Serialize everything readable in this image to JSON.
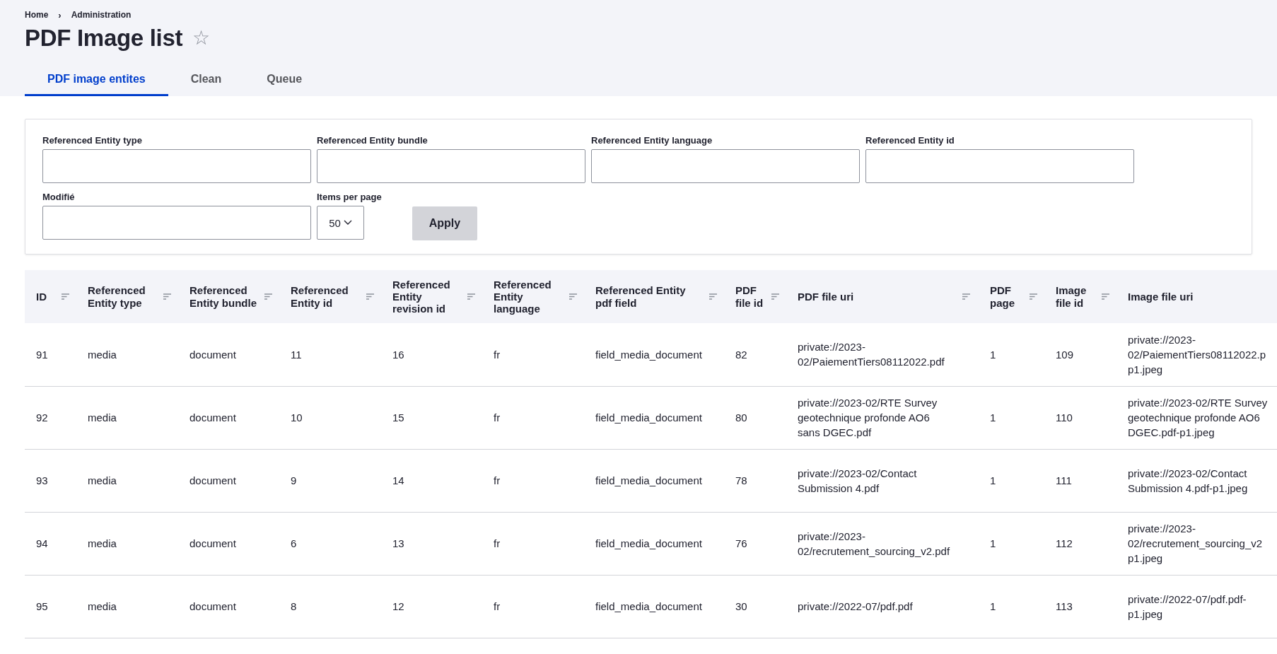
{
  "breadcrumb": [
    {
      "label": "Home"
    },
    {
      "label": "Administration"
    }
  ],
  "breadcrumb_separator": "›",
  "title": "PDF Image list",
  "favorite": {
    "symbol": "☆",
    "selected": false
  },
  "tabs": [
    {
      "label": "PDF image entites",
      "selected": true
    },
    {
      "label": "Clean",
      "selected": false
    },
    {
      "label": "Queue",
      "selected": false
    }
  ],
  "filters": [
    {
      "label": "Referenced Entity type",
      "kind": "text"
    },
    {
      "label": "Referenced Entity bundle",
      "kind": "text"
    },
    {
      "label": "Referenced Entity language",
      "kind": "text"
    },
    {
      "label": "Referenced Entity id",
      "kind": "text"
    },
    {
      "label": "Modifié",
      "kind": "text"
    },
    {
      "label": "Items per page",
      "kind": "select",
      "value": "50"
    }
  ],
  "apply_button": "Apply",
  "table": {
    "columns": [
      {
        "label": "ID",
        "sortable": true
      },
      {
        "label": "Referenced Entity type",
        "sortable": true
      },
      {
        "label": "Referenced Entity bundle",
        "sortable": true
      },
      {
        "label": "Referenced Entity id",
        "sortable": true
      },
      {
        "label": "Referenced Entity revision id",
        "sortable": true
      },
      {
        "label": "Referenced Entity language",
        "sortable": true
      },
      {
        "label": "Referenced Entity pdf field",
        "sortable": true
      },
      {
        "label": "PDF file id",
        "sortable": true
      },
      {
        "label": "PDF file uri",
        "sortable": true
      },
      {
        "label": "PDF page",
        "sortable": true
      },
      {
        "label": "Image file id",
        "sortable": true
      },
      {
        "label": "Image file uri",
        "sortable": false
      }
    ],
    "rows": [
      [
        "91",
        "media",
        "document",
        "11",
        "16",
        "fr",
        "field_media_document",
        "82",
        "private://2023-02/PaiementTiers08112022.pdf",
        "1",
        "109",
        "private://2023-\n02/PaiementTiers08112022.p\np1.jpeg"
      ],
      [
        "92",
        "media",
        "document",
        "10",
        "15",
        "fr",
        "field_media_document",
        "80",
        "private://2023-02/RTE Survey geotechnique profonde AO6 sans DGEC.pdf",
        "1",
        "110",
        "private://2023-02/RTE Survey\ngeotechnique profonde AO6\nDGEC.pdf-p1.jpeg"
      ],
      [
        "93",
        "media",
        "document",
        "9",
        "14",
        "fr",
        "field_media_document",
        "78",
        "private://2023-02/Contact Submission 4.pdf",
        "1",
        "111",
        "private://2023-02/Contact\nSubmission 4.pdf-p1.jpeg"
      ],
      [
        "94",
        "media",
        "document",
        "6",
        "13",
        "fr",
        "field_media_document",
        "76",
        "private://2023-02/recrutement_sourcing_v2.pdf",
        "1",
        "112",
        "private://2023-\n02/recrutement_sourcing_v2\np1.jpeg"
      ],
      [
        "95",
        "media",
        "document",
        "8",
        "12",
        "fr",
        "field_media_document",
        "30",
        "private://2022-07/pdf.pdf",
        "1",
        "113",
        "private://2022-07/pdf.pdf-\np1.jpeg"
      ]
    ]
  }
}
